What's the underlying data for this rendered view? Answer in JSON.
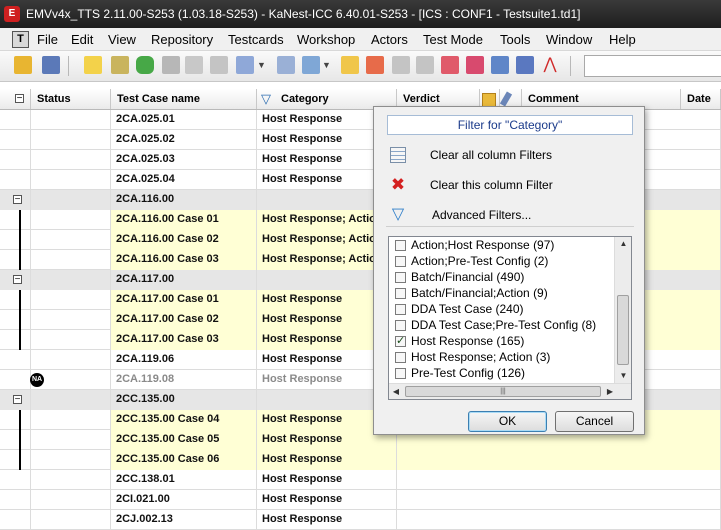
{
  "window": {
    "title": "EMVv4x_TTS 2.11.00-S253 (1.03.18-S253)  -  KaNest-ICC 6.40.01-S253 - [ICS : CONF1 - Testsuite1.td1]"
  },
  "menu": {
    "items": [
      "File",
      "Edit",
      "View",
      "Repository",
      "Testcards",
      "Workshop",
      "Actors",
      "Test Mode",
      "Tools",
      "Window",
      "Help"
    ]
  },
  "grid": {
    "columns": {
      "status": "Status",
      "name": "Test Case name",
      "category": "Category",
      "verdict": "Verdict",
      "comment": "Comment",
      "date": "Date"
    },
    "rows": [
      {
        "type": "normal",
        "name": "2CA.025.01",
        "category": "Host Response"
      },
      {
        "type": "normal",
        "name": "2CA.025.02",
        "category": "Host Response"
      },
      {
        "type": "normal",
        "name": "2CA.025.03",
        "category": "Host Response"
      },
      {
        "type": "normal",
        "name": "2CA.025.04",
        "category": "Host Response"
      },
      {
        "type": "group",
        "name": "2CA.116.00",
        "category": ""
      },
      {
        "type": "yellow",
        "name": "2CA.116.00 Case 01",
        "category": "Host Response; Actio"
      },
      {
        "type": "yellow",
        "name": "2CA.116.00 Case 02",
        "category": "Host Response; Actio"
      },
      {
        "type": "yellow",
        "name": "2CA.116.00 Case 03",
        "category": "Host Response; Actio"
      },
      {
        "type": "group",
        "name": "2CA.117.00",
        "category": ""
      },
      {
        "type": "yellow",
        "name": "2CA.117.00 Case 01",
        "category": "Host Response"
      },
      {
        "type": "yellow",
        "name": "2CA.117.00 Case 02",
        "category": "Host Response"
      },
      {
        "type": "yellow",
        "name": "2CA.117.00 Case 03",
        "category": "Host Response"
      },
      {
        "type": "normal",
        "name": "2CA.119.06",
        "category": "Host Response"
      },
      {
        "type": "na",
        "name": "2CA.119.08",
        "category": "Host Response",
        "status": "NA"
      },
      {
        "type": "group",
        "name": "2CC.135.00",
        "category": ""
      },
      {
        "type": "yellow",
        "name": "2CC.135.00 Case 04",
        "category": "Host Response"
      },
      {
        "type": "yellow",
        "name": "2CC.135.00 Case 05",
        "category": "Host Response"
      },
      {
        "type": "yellow",
        "name": "2CC.135.00 Case 06",
        "category": "Host Response"
      },
      {
        "type": "normal",
        "name": "2CC.138.01",
        "category": "Host Response"
      },
      {
        "type": "normal",
        "name": "2CI.021.00",
        "category": "Host Response"
      },
      {
        "type": "normal",
        "name": "2CJ.002.13",
        "category": "Host Response"
      }
    ]
  },
  "filter_popup": {
    "title": "Filter for \"Category\"",
    "clear_all": "Clear all column Filters",
    "clear_this": "Clear this column Filter",
    "advanced": "Advanced Filters...",
    "options": [
      {
        "label": "Action;Host Response (97)",
        "checked": false
      },
      {
        "label": "Action;Pre-Test Config (2)",
        "checked": false
      },
      {
        "label": "Batch/Financial (490)",
        "checked": false
      },
      {
        "label": "Batch/Financial;Action (9)",
        "checked": false
      },
      {
        "label": "DDA Test Case (240)",
        "checked": false
      },
      {
        "label": "DDA Test Case;Pre-Test Config (8)",
        "checked": false
      },
      {
        "label": "Host Response (165)",
        "checked": true
      },
      {
        "label": "Host Response; Action (3)",
        "checked": false
      },
      {
        "label": "Pre-Test Config (126)",
        "checked": false
      }
    ],
    "ok_label": "OK",
    "cancel_label": "Cancel"
  }
}
